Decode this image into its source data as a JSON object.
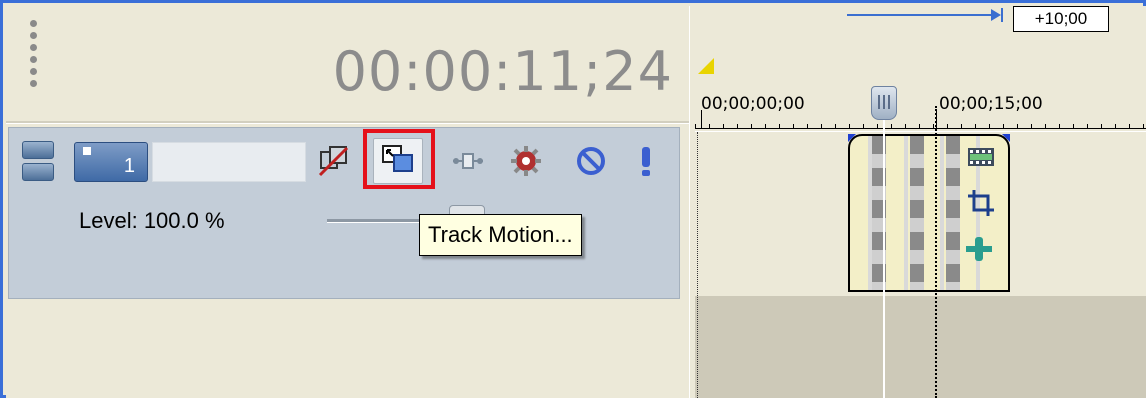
{
  "header": {
    "timecode": "00:00:11;24"
  },
  "track": {
    "number": "1",
    "name_value": "",
    "level_label": "Level: 100.0 %"
  },
  "tooltip": {
    "text": "Track Motion..."
  },
  "timeline": {
    "offset_label": "+10;00",
    "ruler_labels": [
      "00;00;00;00",
      "00;00;15;00"
    ]
  },
  "colors": {
    "highlight": "#e5101a",
    "accent": "#3b6fd0"
  },
  "icons": {
    "grip": "drag-grip-icon",
    "expand": "expand-track-icon",
    "composite": "composite-mode-icon",
    "track_motion": "track-motion-icon",
    "bypass": "parent-child-icon",
    "fx": "track-fx-icon",
    "mute": "mute-icon",
    "solo": "solo-icon",
    "clip_film": "film-event-icon",
    "clip_crop": "crop-icon",
    "clip_fx": "event-fx-icon"
  }
}
